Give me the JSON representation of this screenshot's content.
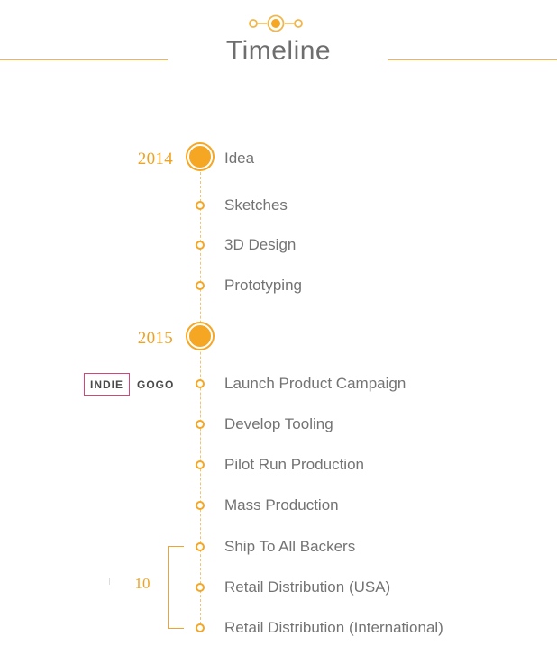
{
  "header": {
    "title": "Timeline"
  },
  "colors": {
    "accent": "#f5a623",
    "rule": "#f2b64a",
    "text": "#737373",
    "logo_border": "#d6457a"
  },
  "groups": [
    {
      "year": "2014",
      "items": [
        "Idea",
        "Sketches",
        "3D Design",
        "Prototyping"
      ]
    },
    {
      "year": "2015",
      "items": [
        "Launch Product Campaign",
        "Develop Tooling",
        "Pilot Run Production",
        "Mass Production",
        "Ship To All Backers",
        "Retail Distribution (USA)",
        "Retail Distribution (International)"
      ]
    }
  ],
  "logo": {
    "part1": "INDIE",
    "part2": "GOGO"
  },
  "bracket": {
    "count": "10"
  }
}
